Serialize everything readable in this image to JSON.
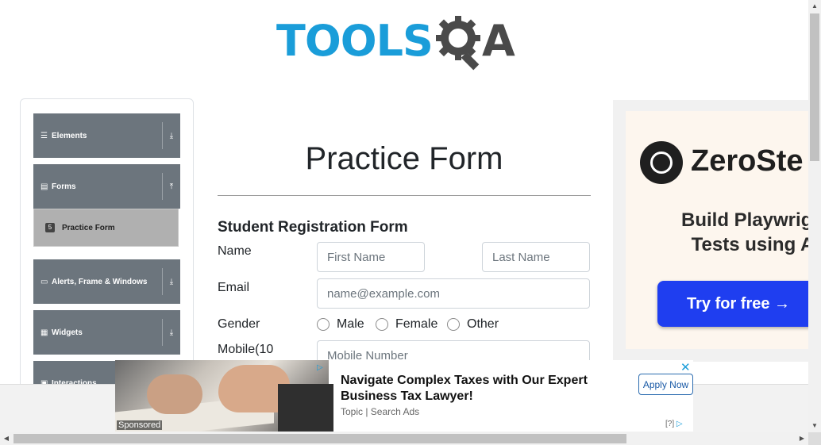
{
  "header": {
    "logo_text": "TOOLS",
    "logo_suffix": "A"
  },
  "sidebar": {
    "groups": [
      {
        "label": "Elements",
        "icon": "hamburger-icon",
        "glyph": "☰",
        "arrow": "⤓"
      },
      {
        "label": "Forms",
        "icon": "document-icon",
        "glyph": "▤",
        "arrow": "⤒"
      },
      {
        "label": "Alerts, Frame & Windows",
        "icon": "window-icon",
        "glyph": "▭",
        "arrow": "⤓"
      },
      {
        "label": "Widgets",
        "icon": "grid-icon",
        "glyph": "▦",
        "arrow": "⤓"
      },
      {
        "label": "Interactions",
        "icon": "interactions-icon",
        "glyph": "▣",
        "arrow": "⤓"
      }
    ],
    "active_sub_item": {
      "label": "Practice Form",
      "glyph": "5"
    }
  },
  "main": {
    "page_title": "Practice Form",
    "form_heading": "Student Registration Form",
    "name_label": "Name",
    "first_name_placeholder": "First Name",
    "last_name_placeholder": "Last Name",
    "email_label": "Email",
    "email_placeholder": "name@example.com",
    "gender_label": "Gender",
    "gender_options": [
      "Male",
      "Female",
      "Other"
    ],
    "mobile_label": "Mobile(10",
    "mobile_placeholder": "Mobile Number"
  },
  "right_ad": {
    "brand": "ZeroSte",
    "tagline_line1": "Build Playwrigh",
    "tagline_line2": "Tests using A",
    "cta": "Try for free →",
    "accent_color": "#1f3ef0"
  },
  "bottom_ad": {
    "headline": "Navigate Complex Taxes with Our Expert Business Tax Lawyer!",
    "source": "Topic | Search Ads",
    "apply_label": "Apply Now",
    "sponsored": "Sponsored",
    "info_text": "[?]",
    "close_glyph": "✕",
    "adchoices_glyph": "▷"
  },
  "scrollbars": {
    "up_glyph": "▲",
    "down_glyph": "▼",
    "left_glyph": "◀",
    "right_glyph": "▶"
  },
  "colors": {
    "brand_blue": "#1a9dd9",
    "sidebar_group_bg": "#6c757d",
    "active_item_bg": "#b0b0b0"
  }
}
